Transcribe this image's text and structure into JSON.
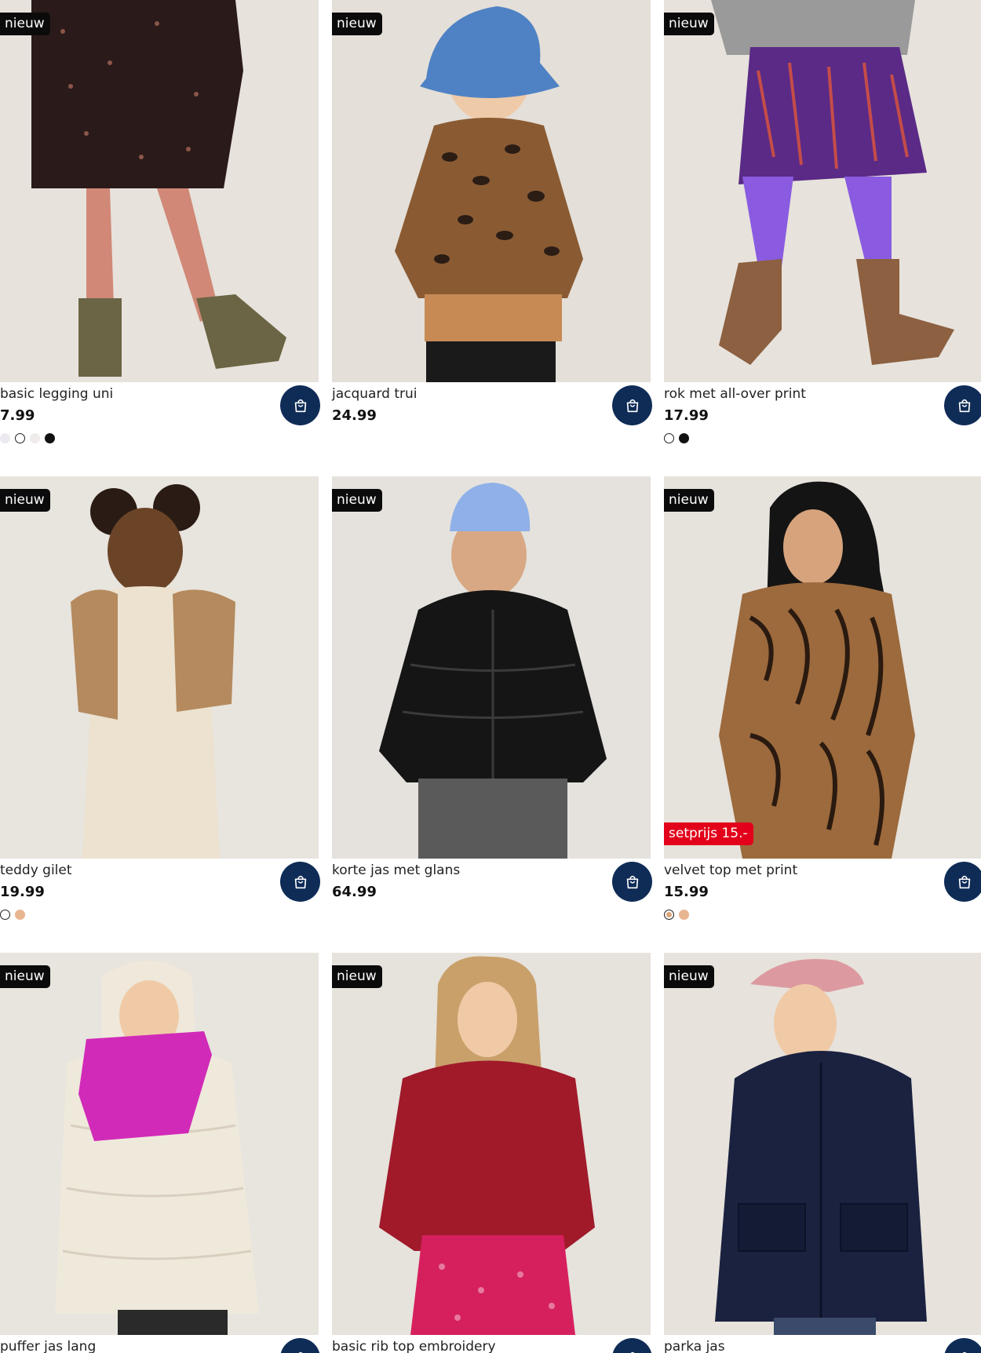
{
  "products": [
    {
      "name": "basic legging uni",
      "price": "7.99",
      "badge": "nieuw",
      "promo": "",
      "swatches": [
        "#eceaf0",
        "#ffffff",
        "#efebea",
        "#111111"
      ],
      "selected": 1
    },
    {
      "name": "jacquard trui",
      "price": "24.99",
      "badge": "nieuw",
      "promo": "",
      "swatches": [],
      "selected": -1
    },
    {
      "name": "rok met all-over print",
      "price": "17.99",
      "badge": "nieuw",
      "promo": "",
      "swatches": [
        "#ffffff",
        "#111111"
      ],
      "selected": 0
    },
    {
      "name": "teddy gilet",
      "price": "19.99",
      "badge": "nieuw",
      "promo": "",
      "swatches": [
        "#ffffff",
        "#e8b591"
      ],
      "selected": 0
    },
    {
      "name": "korte jas met glans",
      "price": "64.99",
      "badge": "nieuw",
      "promo": "",
      "swatches": [],
      "selected": -1
    },
    {
      "name": "velvet top met print",
      "price": "15.99",
      "badge": "nieuw",
      "promo": "setprijs 15.-",
      "swatches": [
        "#d9a57a",
        "#e8b591"
      ],
      "selected": 0
    },
    {
      "name": "puffer jas lang",
      "price": "",
      "badge": "nieuw",
      "promo": "",
      "swatches": [],
      "selected": -1
    },
    {
      "name": "basic rib top embroidery",
      "price": "",
      "badge": "nieuw",
      "promo": "",
      "swatches": [],
      "selected": -1
    },
    {
      "name": "parka jas",
      "price": "",
      "badge": "nieuw",
      "promo": "",
      "swatches": [],
      "selected": -1
    }
  ],
  "icons": {
    "cart": "shopping-bag-icon"
  },
  "colors": {
    "cart_button": "#0f2c57",
    "badge_new": "#0b0b0b",
    "badge_promo": "#e2001a"
  }
}
